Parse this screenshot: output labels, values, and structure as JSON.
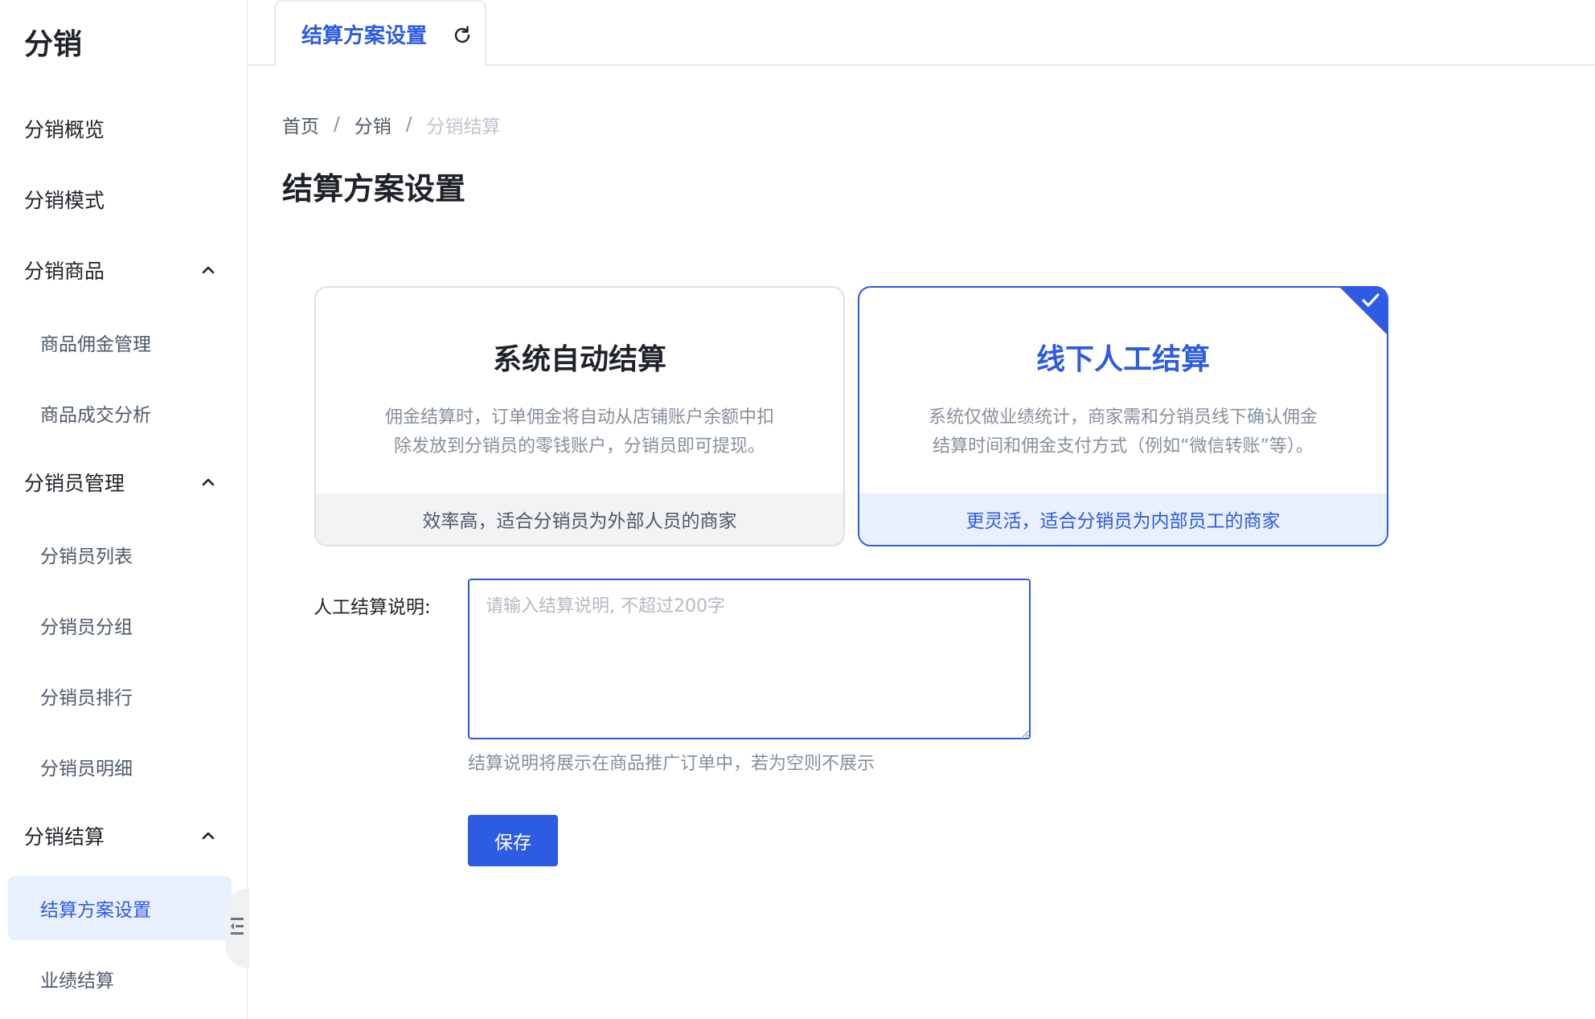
{
  "sidebar": {
    "brand": "分销",
    "items": [
      {
        "label": "分销概览"
      },
      {
        "label": "分销模式"
      },
      {
        "label": "分销商品",
        "expanded": true
      },
      {
        "label": "商品佣金管理"
      },
      {
        "label": "商品成交分析"
      },
      {
        "label": "分销员管理",
        "expanded": true
      },
      {
        "label": "分销员列表"
      },
      {
        "label": "分销员分组"
      },
      {
        "label": "分销员排行"
      },
      {
        "label": "分销员明细"
      },
      {
        "label": "分销结算",
        "expanded": true
      },
      {
        "label": "结算方案设置",
        "active": true
      },
      {
        "label": "业绩结算"
      }
    ]
  },
  "tabs": [
    {
      "label": "结算方案设置",
      "active": true
    }
  ],
  "breadcrumb": {
    "home": "首页",
    "section": "分销",
    "current": "分销结算",
    "separator": "/"
  },
  "page_title": "结算方案设置",
  "options": [
    {
      "title": "系统自动结算",
      "desc_line1": "佣金结算时，订单佣金将自动从店铺账户余额中扣",
      "desc_line2": "除发放到分销员的零钱账户，分销员即可提现。",
      "footer": "效率高，适合分销员为外部人员的商家",
      "selected": false
    },
    {
      "title": "线下人工结算",
      "desc_line1": "系统仅做业绩统计，商家需和分销员线下确认佣金",
      "desc_line2": "结算时间和佣金支付方式（例如“微信转账”等）。",
      "footer": "更灵活，适合分销员为内部员工的商家",
      "selected": true
    }
  ],
  "form": {
    "label": "人工结算说明:",
    "value": "",
    "placeholder": "请输入结算说明, 不超过200字",
    "hint": "结算说明将展示在商品推广订单中，若为空则不展示"
  },
  "save_label": "保存",
  "colors": {
    "accent": "#2d5be3",
    "accent_bg": "#e8effd",
    "text": "#1f2329",
    "muted": "#86909c"
  }
}
